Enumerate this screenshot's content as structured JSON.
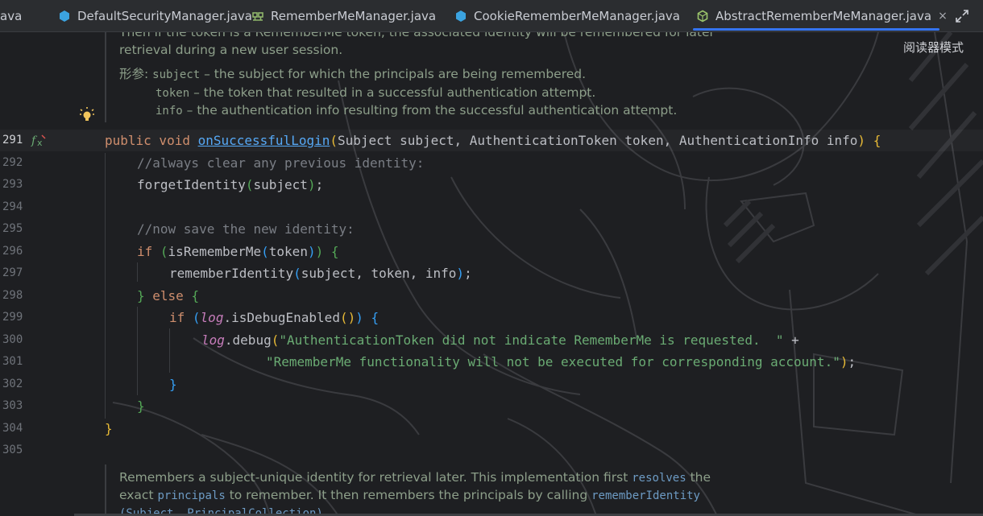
{
  "tabs": [
    {
      "label": "ava",
      "icon": "none",
      "active": false
    },
    {
      "label": "DefaultSecurityManager.java",
      "icon": "class-icon",
      "active": false
    },
    {
      "label": "RememberMeManager.java",
      "icon": "interface-icon",
      "active": false
    },
    {
      "label": "CookieRememberMeManager.java",
      "icon": "class-icon",
      "active": false
    },
    {
      "label": "AbstractRememberMeManager.java",
      "icon": "abstract-class-icon",
      "active": true,
      "close": "×"
    }
  ],
  "reader_mode": "阅读器模式",
  "doc_top": {
    "line1": "Then if the token is a RememberMe token, the associated identity will be remembered for later",
    "line2": "retrieval during a new user session.",
    "params_label": "形参:",
    "params": [
      {
        "name": "subject",
        "desc": " – the subject for which the principals are being remembered."
      },
      {
        "name": "token",
        "desc": " – the token that resulted in a successful authentication attempt."
      },
      {
        "name": "info",
        "desc": " – the authentication info resulting from the successful authentication attempt."
      }
    ]
  },
  "line_numbers": [
    "291",
    "292",
    "293",
    "294",
    "295",
    "296",
    "297",
    "298",
    "299",
    "300",
    "301",
    "302",
    "303",
    "304",
    "305"
  ],
  "code": {
    "l291_kw": "public void ",
    "l291_fn": "onSuccessfulLogin",
    "l291_rest": "Subject subject, AuthenticationToken token, AuthenticationInfo info",
    "l292": "//always clear any previous identity:",
    "l293_fn": "forgetIdentity",
    "l293_arg": "subject",
    "l295": "//now save the new identity:",
    "l296_kw": "if ",
    "l296_fn": "isRememberMe",
    "l296_arg": "token",
    "l297_fn": "rememberIdentity",
    "l297_arg": "subject, token, info",
    "l298_kw": "else ",
    "l299_kw": "if ",
    "l299_log": "log",
    "l299_fn": ".isDebugEnabled",
    "l300_log": "log",
    "l300_fn": ".debug",
    "l300_str": "\"AuthenticationToken did not indicate RememberMe is requested.  \"",
    "l300_op": " +",
    "l301_str": "\"RememberMe functionality will not be executed for corresponding account.\""
  },
  "doc_bottom": {
    "t1": "Remembers a subject-unique identity for retrieval later. This implementation first ",
    "l1": "resolves",
    "t2": " the",
    "t3": "exact ",
    "l2": "principals",
    "t4": " to remember. It then remembers the principals by calling ",
    "l3": "rememberIdentity",
    "l4": "(Subject, PrincipalCollection)",
    "t5": "."
  },
  "colors": {
    "background": "#1e1f22",
    "keyword": "#cf8e6d",
    "function": "#56a8f5",
    "comment": "#7a7e85",
    "string": "#6aab73",
    "tab_underline": "#3574f0"
  }
}
